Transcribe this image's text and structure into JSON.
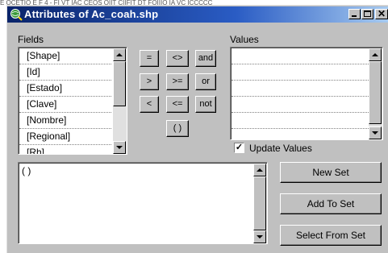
{
  "background_strip_text": "E  OCETIO  E  F 4 - FI VT  IAC     CEOS  OIIT  CIIFIT  DT  FOIIIO  IA       VC  ICCCCC",
  "window": {
    "title": "Attributes of Ac_coah.shp",
    "icon": "globe-query-icon",
    "title_color": "#0a246a"
  },
  "fields": {
    "label": "Fields",
    "items": [
      "[Shape]",
      "[Id]",
      "[Estado]",
      "[Clave]",
      "[Nombre]",
      "[Regional]",
      "[Rh]"
    ]
  },
  "operators": {
    "row1": [
      "=",
      "<>",
      "and"
    ],
    "row2": [
      ">",
      ">=",
      "or"
    ],
    "row3": [
      "<",
      "<=",
      "not"
    ],
    "parens": "( )"
  },
  "values": {
    "label": "Values",
    "items": [
      "",
      "",
      "",
      "",
      "",
      "",
      ""
    ]
  },
  "update_values": {
    "label": "Update Values",
    "checked": true
  },
  "query": {
    "text": "( )"
  },
  "buttons": {
    "new_set": "New Set",
    "add_to_set": "Add To Set",
    "select_from_set": "Select From Set"
  }
}
